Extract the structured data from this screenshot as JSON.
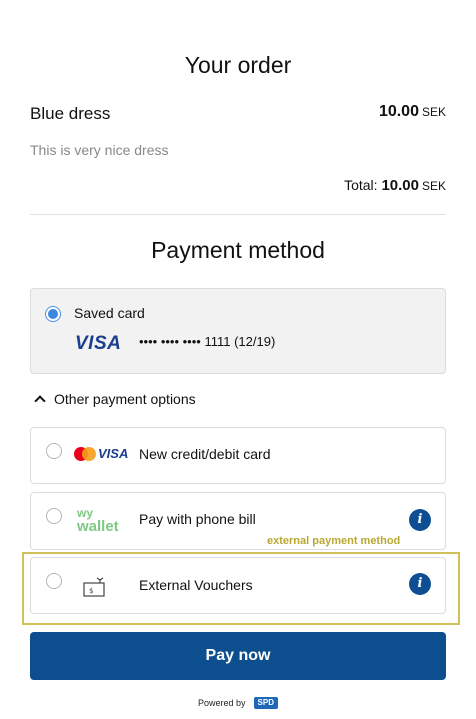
{
  "order": {
    "title": "Your order",
    "item_name": "Blue dress",
    "item_price": "10.00",
    "currency": "SEK",
    "item_description": "This is very nice dress",
    "total_label": "Total:",
    "total_value": "10.00",
    "total_currency": "SEK"
  },
  "payment": {
    "title": "Payment method",
    "saved_card": {
      "label": "Saved card",
      "brand": "VISA",
      "masked_number": "•••• •••• •••• 1111 (12/19)"
    },
    "other_toggle_label": "Other payment options",
    "options": [
      {
        "label": "New credit/debit card",
        "logo": "VISA"
      },
      {
        "label": "Pay with phone bill",
        "logo_line1": "wy",
        "logo_line2": "wallet"
      },
      {
        "label": "External Vouchers"
      }
    ],
    "info_glyph": "i"
  },
  "annotation": {
    "label": "external payment method",
    "color": "#b8a832"
  },
  "pay_button_label": "Pay now",
  "footer": {
    "powered_by": "Powered by",
    "logo_text": "SPD"
  },
  "colors": {
    "primary": "#0d4e8f",
    "radio_selected": "#3b86e0",
    "visa_blue": "#1a3e8c",
    "wywallet_green": "#7fc882"
  }
}
